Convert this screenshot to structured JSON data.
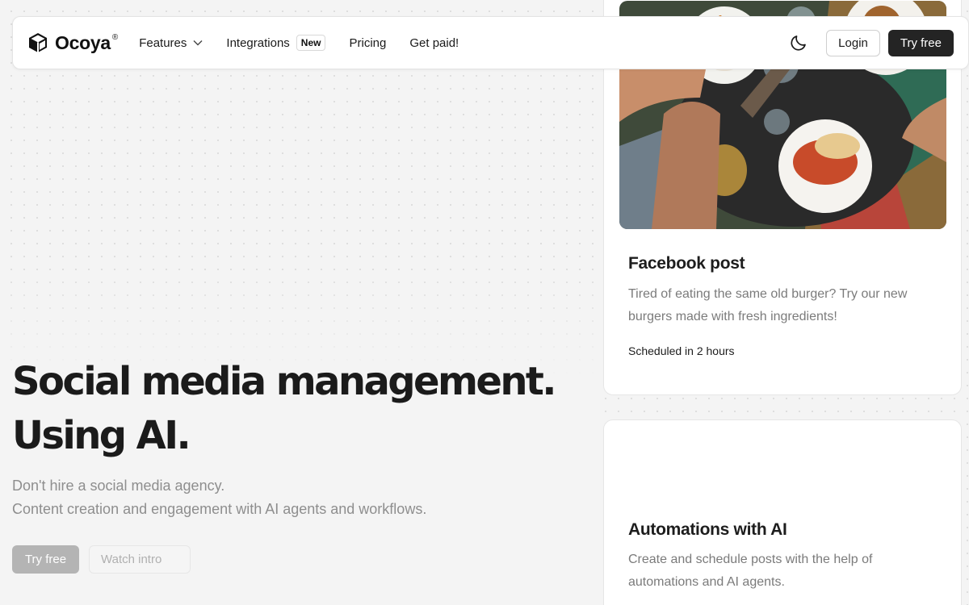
{
  "nav": {
    "brand": "Ocoya",
    "brand_mark": "®",
    "links": {
      "features": "Features",
      "integrations": "Integrations",
      "integrations_badge": "New",
      "pricing": "Pricing",
      "get_paid": "Get paid!"
    },
    "login": "Login",
    "try_free": "Try free",
    "icons": {
      "logo": "cube-logo-icon",
      "features_dropdown": "chevron-down-icon",
      "theme": "moon-icon"
    }
  },
  "hero": {
    "title_line1": "Social media management.",
    "title_line2": "Using AI.",
    "sub_line1": "Don't hire a social media agency.",
    "sub_line2": "Content creation and engagement with AI agents and workflows.",
    "try_free": "Try free",
    "watch_intro": "Watch intro"
  },
  "cards": [
    {
      "title": "Facebook post",
      "text": "Tired of eating the same old burger? Try our new burgers made with fresh ingredients!",
      "meta": "Scheduled in 2 hours",
      "image": "food-table-photo"
    },
    {
      "title": "Automations with AI",
      "text": "Create and schedule posts with the help of automations and AI agents."
    }
  ],
  "colors": {
    "primary_button": "#242424",
    "page_background": "#f4f4f4",
    "muted_text": "#8e8e8e"
  }
}
